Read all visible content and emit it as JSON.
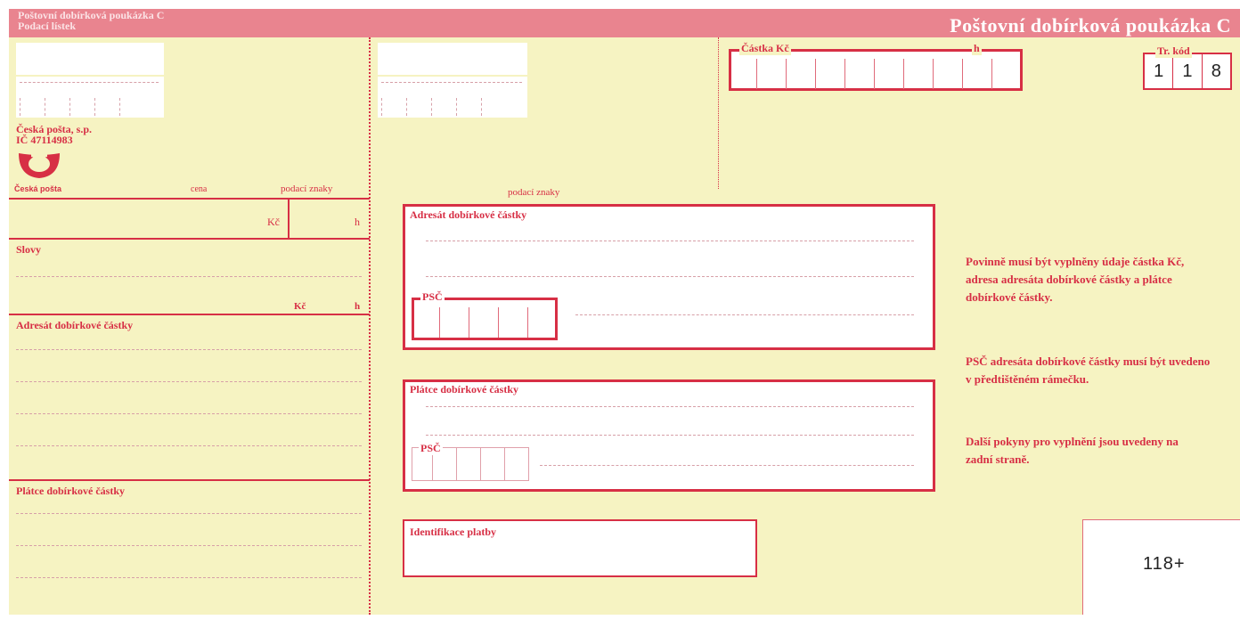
{
  "header": {
    "stub_title_line1": "Poštovní dobírková poukázka C",
    "stub_title_line2": "Podací lístek",
    "main_title": "Poštovní dobírková poukázka C"
  },
  "stub": {
    "post_name": "Česká pošta, s.p.",
    "post_ic": "IČ 47114983",
    "logo_caption": "Česká pošta",
    "price_label": "cena",
    "stamp_label": "podací znaky",
    "kc_label": "Kč",
    "h_label": "h",
    "words_label": "Slovy",
    "kc_label2": "Kč",
    "h_label2": "h",
    "addressee_label": "Adresát dobírkové částky",
    "payer_label": "Plátce dobírkové částky"
  },
  "main": {
    "amount_label": "Částka Kč",
    "amount_h_label": "h",
    "trcode_label": "Tr. kód",
    "trcode_digits": [
      "1",
      "1",
      "8"
    ],
    "stamp_label": "podací znaky",
    "addressee_label": "Adresát dobírkové částky",
    "addressee_psc_label": "PSČ",
    "payer_label": "Plátce dobírkové částky",
    "payer_psc_label": "PSČ",
    "payment_id_label": "Identifikace platby",
    "code_number": "118+"
  },
  "instructions": {
    "para1": "Povinně musí být vyplněny údaje částka Kč, adresa adresáta dobírkové částky a plátce dobírkové částky.",
    "para2": "PSČ adresáta dobírkové částky musí být uvedeno v předtištěném rámečku.",
    "para3": "Další pokyny pro vyplnění jsou uvedeny na zadní straně."
  },
  "colors": {
    "paper": "#f6f3c2",
    "accent_red": "#d72f45",
    "header_pink": "#e9848f"
  }
}
